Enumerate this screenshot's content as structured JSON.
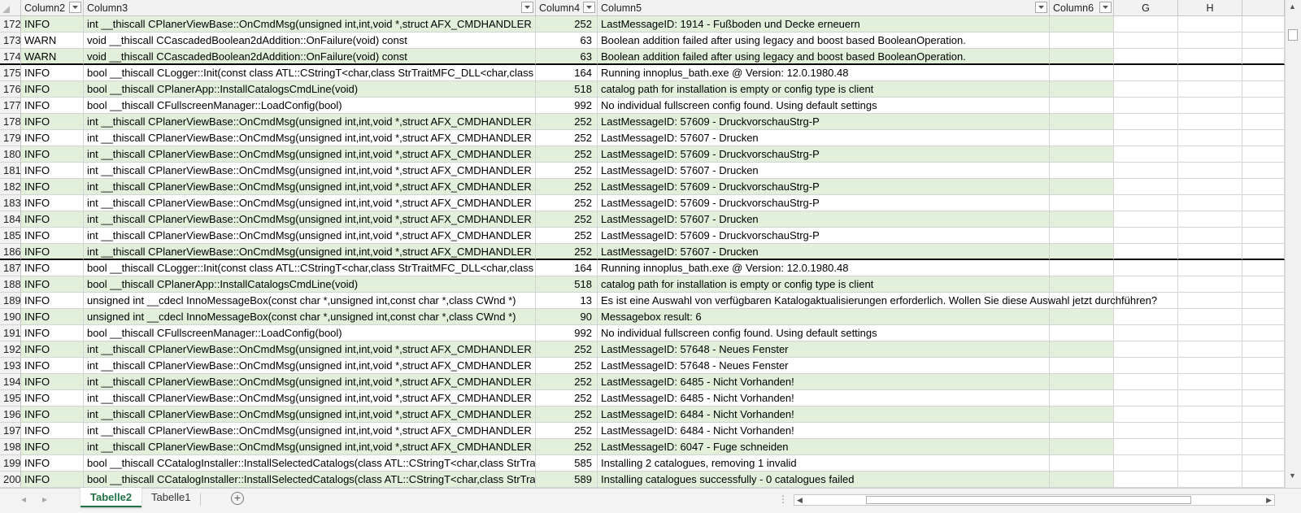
{
  "workbook": {
    "columns": {
      "corner": "",
      "col2": "Column2",
      "col3": "Column3",
      "col4": "Column4",
      "col5": "Column5",
      "col6": "Column6",
      "g": "G",
      "h": "H"
    },
    "filter_icon": "dropdown-arrow",
    "band_color": "#e2efda",
    "rows": [
      {
        "num": "172",
        "level": "INFO",
        "func": "int __thiscall CPlanerViewBase::OnCmdMsg(unsigned int,int,void *,struct AFX_CMDHANDLER",
        "n": "252",
        "msg": "LastMessageID: 1914  -  Fußboden und Decke erneuern",
        "band": true,
        "sep": false
      },
      {
        "num": "173",
        "level": "WARN",
        "func": "void __thiscall CCascadedBoolean2dAddition::OnFailure(void) const",
        "n": "63",
        "msg": "Boolean addition failed after using legacy and boost based BooleanOperation.",
        "band": false,
        "sep": false
      },
      {
        "num": "174",
        "level": "WARN",
        "func": "void __thiscall CCascadedBoolean2dAddition::OnFailure(void) const",
        "n": "63",
        "msg": "Boolean addition failed after using legacy and boost based BooleanOperation.",
        "band": true,
        "sep": true
      },
      {
        "num": "175",
        "level": "INFO",
        "func": "bool __thiscall CLogger::Init(const class ATL::CStringT<char,class StrTraitMFC_DLL<char,class",
        "n": "164",
        "msg": "Running innoplus_bath.exe @ Version: 12.0.1980.48",
        "band": false,
        "sep": false
      },
      {
        "num": "176",
        "level": "INFO",
        "func": "bool __thiscall CPlanerApp::InstallCatalogsCmdLine(void)",
        "n": "518",
        "msg": "catalog path for installation is empty or config type is client",
        "band": true,
        "sep": false
      },
      {
        "num": "177",
        "level": "INFO",
        "func": "bool __thiscall CFullscreenManager::LoadConfig(bool)",
        "n": "992",
        "msg": "No individual fullscreen config found. Using default settings",
        "band": false,
        "sep": false
      },
      {
        "num": "178",
        "level": "INFO",
        "func": "int __thiscall CPlanerViewBase::OnCmdMsg(unsigned int,int,void *,struct AFX_CMDHANDLER",
        "n": "252",
        "msg": "LastMessageID: 57609  -  DruckvorschauStrg-P",
        "band": true,
        "sep": false
      },
      {
        "num": "179",
        "level": "INFO",
        "func": "int __thiscall CPlanerViewBase::OnCmdMsg(unsigned int,int,void *,struct AFX_CMDHANDLER",
        "n": "252",
        "msg": "LastMessageID: 57607  -  Drucken",
        "band": false,
        "sep": false
      },
      {
        "num": "180",
        "level": "INFO",
        "func": "int __thiscall CPlanerViewBase::OnCmdMsg(unsigned int,int,void *,struct AFX_CMDHANDLER",
        "n": "252",
        "msg": "LastMessageID: 57609  -  DruckvorschauStrg-P",
        "band": true,
        "sep": false
      },
      {
        "num": "181",
        "level": "INFO",
        "func": "int __thiscall CPlanerViewBase::OnCmdMsg(unsigned int,int,void *,struct AFX_CMDHANDLER",
        "n": "252",
        "msg": "LastMessageID: 57607  -  Drucken",
        "band": false,
        "sep": false
      },
      {
        "num": "182",
        "level": "INFO",
        "func": "int __thiscall CPlanerViewBase::OnCmdMsg(unsigned int,int,void *,struct AFX_CMDHANDLER",
        "n": "252",
        "msg": "LastMessageID: 57609  -  DruckvorschauStrg-P",
        "band": true,
        "sep": false
      },
      {
        "num": "183",
        "level": "INFO",
        "func": "int __thiscall CPlanerViewBase::OnCmdMsg(unsigned int,int,void *,struct AFX_CMDHANDLER",
        "n": "252",
        "msg": "LastMessageID: 57609  -  DruckvorschauStrg-P",
        "band": false,
        "sep": false
      },
      {
        "num": "184",
        "level": "INFO",
        "func": "int __thiscall CPlanerViewBase::OnCmdMsg(unsigned int,int,void *,struct AFX_CMDHANDLER",
        "n": "252",
        "msg": "LastMessageID: 57607  -  Drucken",
        "band": true,
        "sep": false
      },
      {
        "num": "185",
        "level": "INFO",
        "func": "int __thiscall CPlanerViewBase::OnCmdMsg(unsigned int,int,void *,struct AFX_CMDHANDLER",
        "n": "252",
        "msg": "LastMessageID: 57609  -  DruckvorschauStrg-P",
        "band": false,
        "sep": false
      },
      {
        "num": "186",
        "level": "INFO",
        "func": "int __thiscall CPlanerViewBase::OnCmdMsg(unsigned int,int,void *,struct AFX_CMDHANDLER",
        "n": "252",
        "msg": "LastMessageID: 57607  -  Drucken",
        "band": true,
        "sep": true
      },
      {
        "num": "187",
        "level": "INFO",
        "func": "bool __thiscall CLogger::Init(const class ATL::CStringT<char,class StrTraitMFC_DLL<char,class",
        "n": "164",
        "msg": "Running innoplus_bath.exe @ Version: 12.0.1980.48",
        "band": false,
        "sep": false
      },
      {
        "num": "188",
        "level": "INFO",
        "func": "bool __thiscall CPlanerApp::InstallCatalogsCmdLine(void)",
        "n": "518",
        "msg": "catalog path for installation is empty or config type is client",
        "band": true,
        "sep": false
      },
      {
        "num": "189",
        "level": "INFO",
        "func": "unsigned int __cdecl InnoMessageBox(const char *,unsigned int,const char *,class CWnd *)",
        "n": "13",
        "msg": "Es ist eine Auswahl von verfügbaren Katalogaktualisierungen erforderlich. Wollen Sie diese Auswahl jetzt durchführen?",
        "band": false,
        "sep": false
      },
      {
        "num": "190",
        "level": "INFO",
        "func": "unsigned int __cdecl InnoMessageBox(const char *,unsigned int,const char *,class CWnd *)",
        "n": "90",
        "msg": "Messagebox result: 6",
        "band": true,
        "sep": false
      },
      {
        "num": "191",
        "level": "INFO",
        "func": "bool __thiscall CFullscreenManager::LoadConfig(bool)",
        "n": "992",
        "msg": "No individual fullscreen config found. Using default settings",
        "band": false,
        "sep": false
      },
      {
        "num": "192",
        "level": "INFO",
        "func": "int __thiscall CPlanerViewBase::OnCmdMsg(unsigned int,int,void *,struct AFX_CMDHANDLER",
        "n": "252",
        "msg": "LastMessageID: 57648  -  Neues Fenster",
        "band": true,
        "sep": false
      },
      {
        "num": "193",
        "level": "INFO",
        "func": "int __thiscall CPlanerViewBase::OnCmdMsg(unsigned int,int,void *,struct AFX_CMDHANDLER",
        "n": "252",
        "msg": "LastMessageID: 57648  -  Neues Fenster",
        "band": false,
        "sep": false
      },
      {
        "num": "194",
        "level": "INFO",
        "func": "int __thiscall CPlanerViewBase::OnCmdMsg(unsigned int,int,void *,struct AFX_CMDHANDLER",
        "n": "252",
        "msg": "LastMessageID: 6485  -  Nicht Vorhanden!",
        "band": true,
        "sep": false
      },
      {
        "num": "195",
        "level": "INFO",
        "func": "int __thiscall CPlanerViewBase::OnCmdMsg(unsigned int,int,void *,struct AFX_CMDHANDLER",
        "n": "252",
        "msg": "LastMessageID: 6485  -  Nicht Vorhanden!",
        "band": false,
        "sep": false
      },
      {
        "num": "196",
        "level": "INFO",
        "func": "int __thiscall CPlanerViewBase::OnCmdMsg(unsigned int,int,void *,struct AFX_CMDHANDLER",
        "n": "252",
        "msg": "LastMessageID: 6484  -  Nicht Vorhanden!",
        "band": true,
        "sep": false
      },
      {
        "num": "197",
        "level": "INFO",
        "func": "int __thiscall CPlanerViewBase::OnCmdMsg(unsigned int,int,void *,struct AFX_CMDHANDLER",
        "n": "252",
        "msg": "LastMessageID: 6484  -  Nicht Vorhanden!",
        "band": false,
        "sep": false
      },
      {
        "num": "198",
        "level": "INFO",
        "func": "int __thiscall CPlanerViewBase::OnCmdMsg(unsigned int,int,void *,struct AFX_CMDHANDLER",
        "n": "252",
        "msg": "LastMessageID: 6047  -  Fuge schneiden",
        "band": true,
        "sep": false
      },
      {
        "num": "199",
        "level": "INFO",
        "func": "bool __thiscall CCatalogInstaller::InstallSelectedCatalogs(class ATL::CStringT<char,class StrTraitMFC",
        "n": "585",
        "msg": "Installing 2 catalogues, removing 1 invalid",
        "band": false,
        "sep": false
      },
      {
        "num": "200",
        "level": "INFO",
        "func": "bool __thiscall CCatalogInstaller::InstallSelectedCatalogs(class ATL::CStringT<char,class StrTraitMFC",
        "n": "589",
        "msg": "Installing catalogues successfully - 0 catalogues failed",
        "band": true,
        "sep": false
      }
    ],
    "sheets": [
      {
        "label": "Tabelle2",
        "active": true
      },
      {
        "label": "Tabelle1",
        "active": false
      }
    ],
    "add_sheet_label": "+"
  }
}
